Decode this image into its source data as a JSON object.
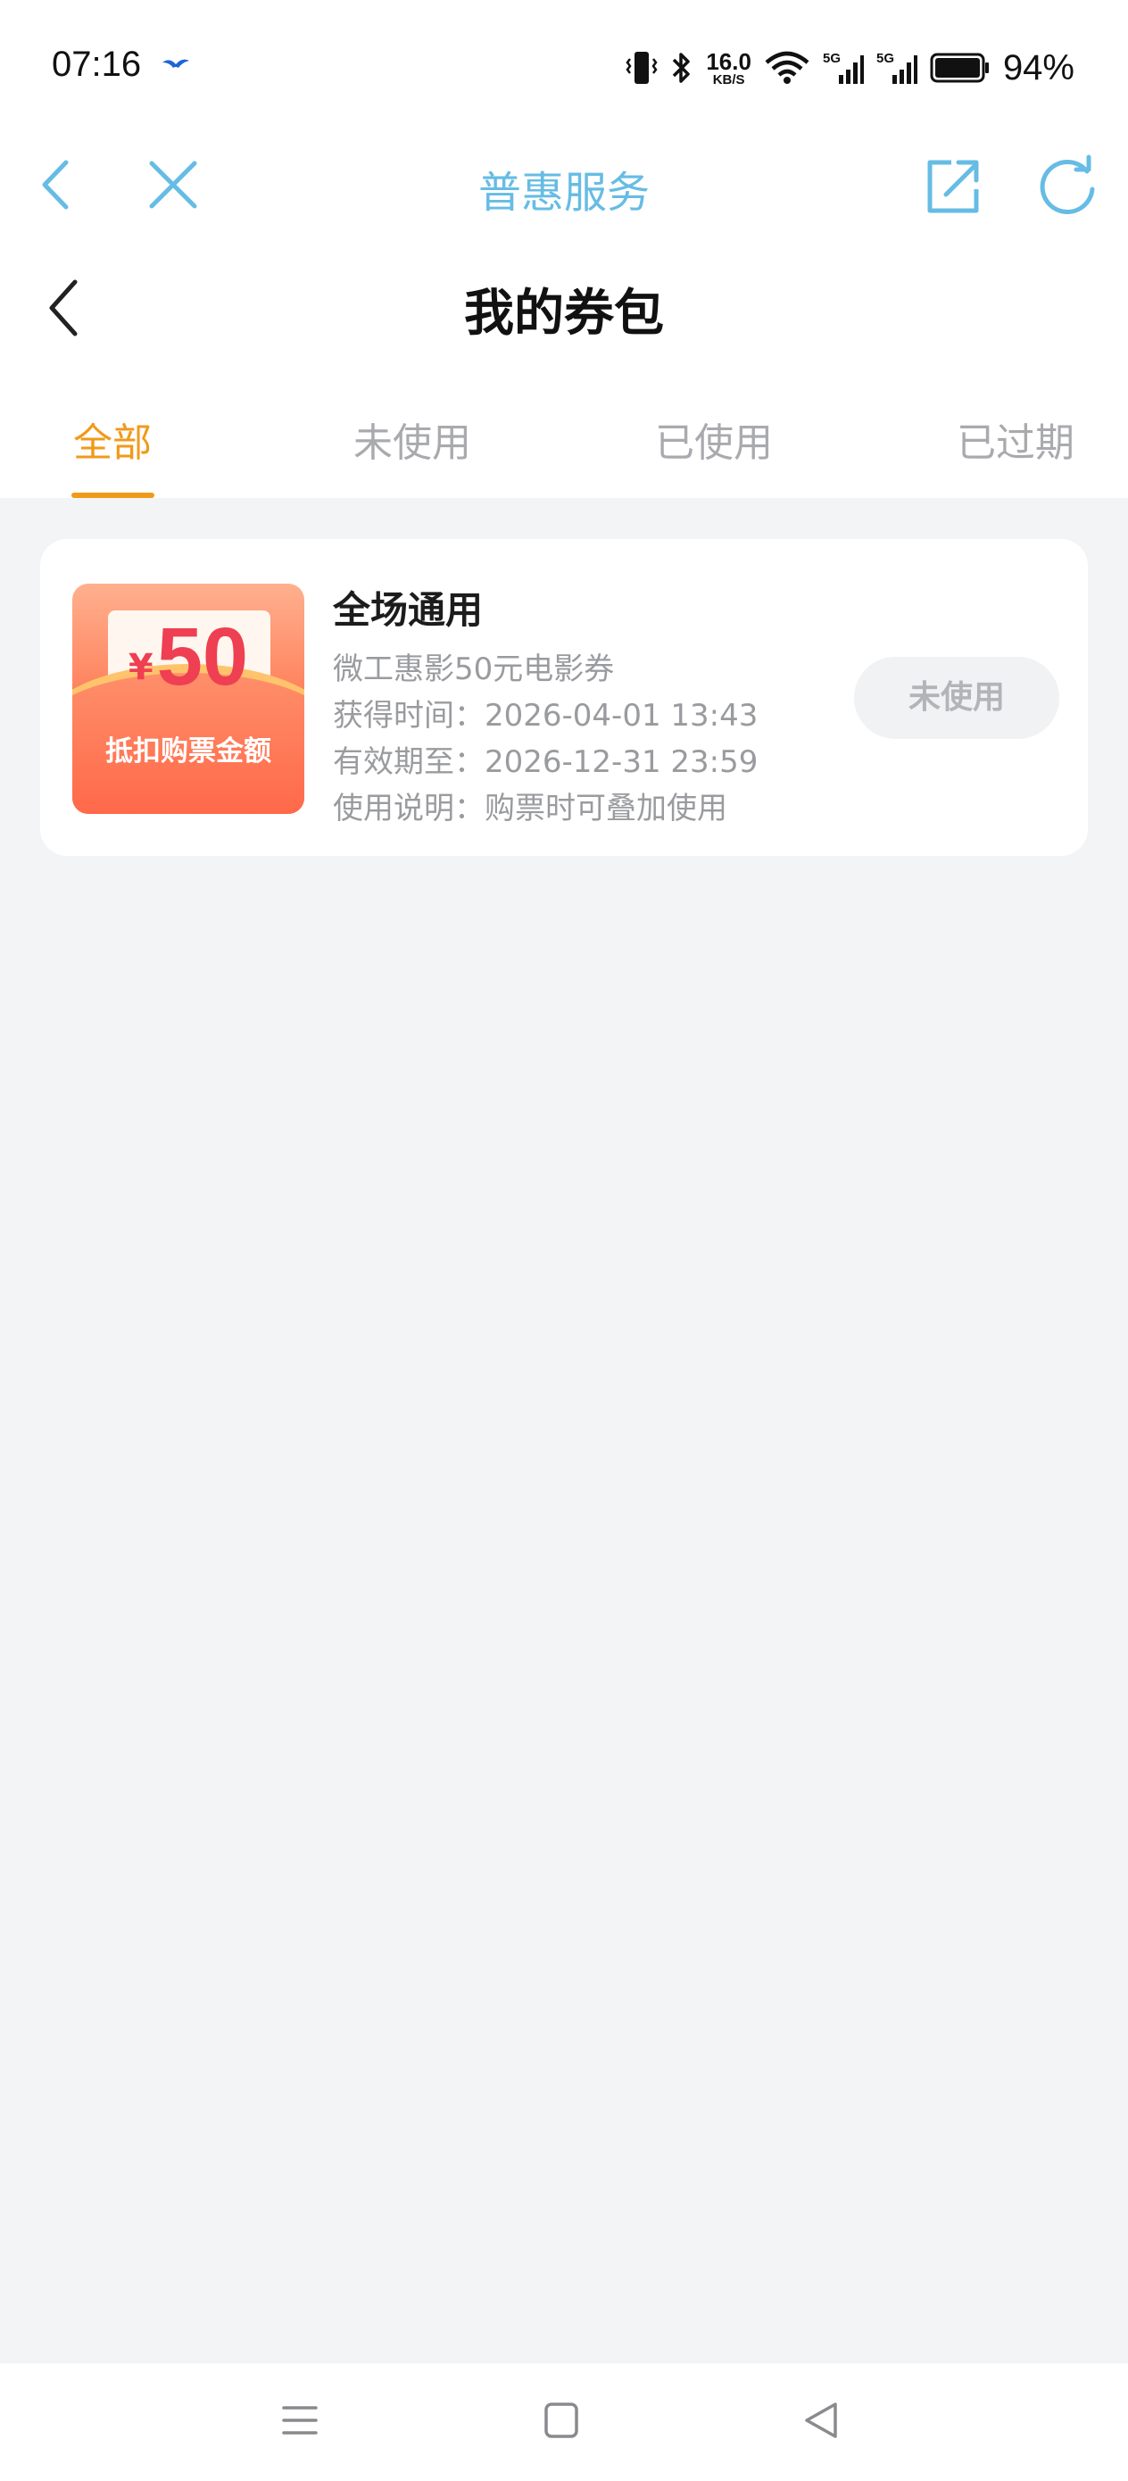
{
  "status_bar": {
    "time": "07:16",
    "net_speed_value": "16.0",
    "net_speed_unit": "KB/S",
    "network_1": "5G",
    "network_2": "5G",
    "battery_percent": "94%"
  },
  "browser": {
    "title": "普惠服务",
    "icons": [
      "back-icon",
      "close-icon",
      "share-icon",
      "refresh-icon"
    ]
  },
  "page": {
    "title": "我的券包"
  },
  "tabs": [
    {
      "label": "全部",
      "active": true
    },
    {
      "label": "未使用",
      "active": false
    },
    {
      "label": "已使用",
      "active": false
    },
    {
      "label": "已过期",
      "active": false
    }
  ],
  "coupons": [
    {
      "image": {
        "currency": "¥",
        "amount": "50",
        "caption": "抵扣购票金额"
      },
      "title": "全场通用",
      "name": "微工惠影50元电影券",
      "obtained": "获得时间：2026-04-01 13:43",
      "valid_until": "有效期至：2026-12-31 23:59",
      "usage": "使用说明：购票时可叠加使用",
      "status": "未使用"
    }
  ],
  "colors": {
    "accent": "#f09a1a",
    "browser_blue": "#66bce4",
    "background": "#f3f4f6",
    "coupon_red": "#ef3f52"
  }
}
